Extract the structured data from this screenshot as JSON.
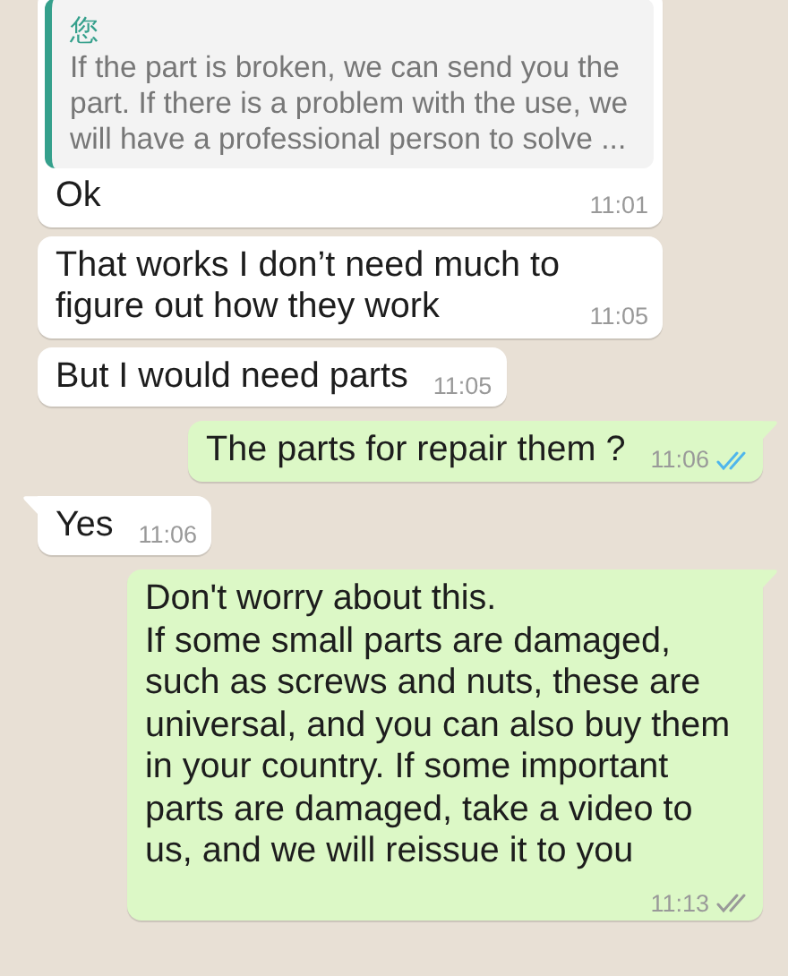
{
  "messages": [
    {
      "kind": "incoming",
      "tail": false,
      "quote": {
        "author": "您",
        "text": "If the part is broken, we can send you the part. If there is a problem with the use, we will have a professional person to solve ..."
      },
      "text": "Ok",
      "time": "11:01"
    },
    {
      "kind": "incoming",
      "tail": false,
      "text": "That works I don’t need much to figure out how they work",
      "time": "11:05"
    },
    {
      "kind": "incoming",
      "tail": false,
      "text": "But I would need parts",
      "time": "11:05"
    },
    {
      "kind": "outgoing",
      "tail": true,
      "text": "The parts for repair them ?",
      "time": "11:06",
      "read": true
    },
    {
      "kind": "incoming",
      "tail": true,
      "text": "Yes",
      "time": "11:06"
    },
    {
      "kind": "outgoing",
      "tail": true,
      "text": "Don't worry about this.\nIf some small parts are damaged, such as screws and nuts, these are universal, and you can also buy them in your country. If some important parts are damaged, take a video to us, and we will reissue it to you",
      "time": "11:13",
      "read": false
    }
  ]
}
